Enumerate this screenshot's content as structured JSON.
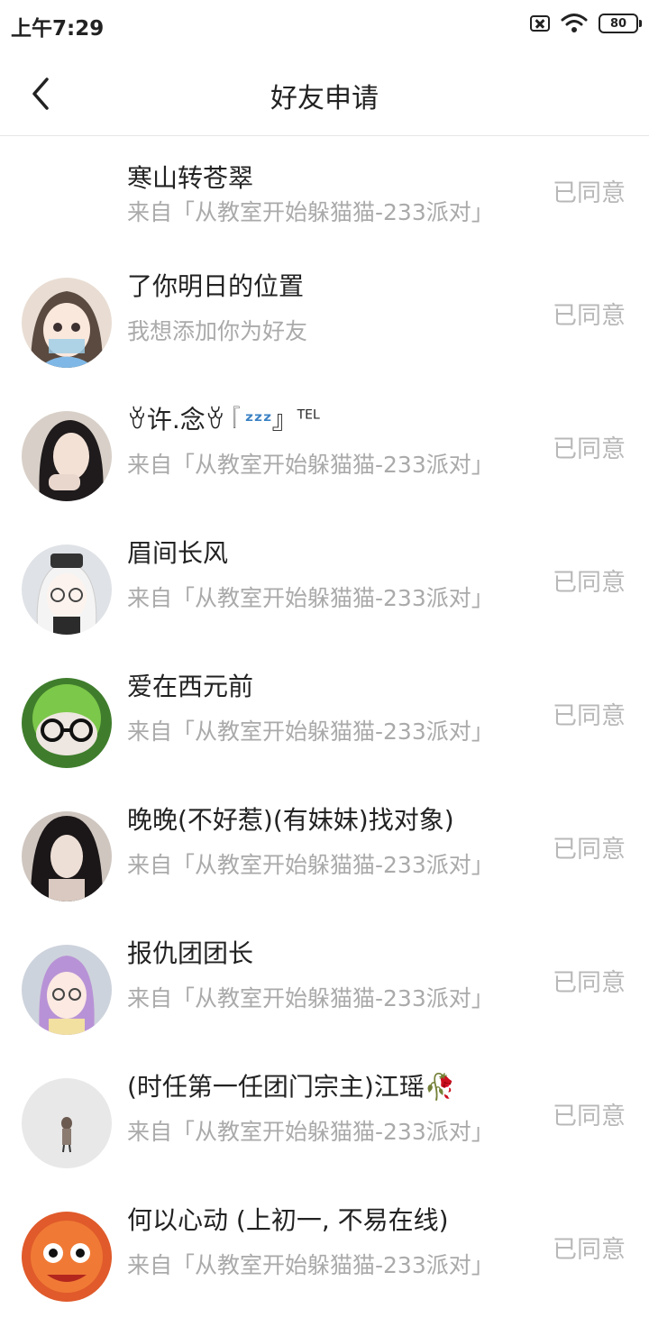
{
  "status_bar": {
    "time": "上午7:29",
    "battery": "80"
  },
  "header": {
    "title": "好友申请"
  },
  "requests": [
    {
      "name": "寒山转苍翠",
      "subtitle": "来自「从教室开始躲猫猫-233派对」",
      "status": "已同意",
      "avatar": "none"
    },
    {
      "name": "了你明日的位置",
      "subtitle": "我想添加你为好友",
      "status": "已同意",
      "avatar": "anime-girl"
    },
    {
      "name": "ꈊ许.念ꈊ『",
      "name_suffix": "』",
      "name_sup": "TEL",
      "subtitle": "来自「从教室开始躲猫猫-233派对」",
      "status": "已同意",
      "avatar": "photo-girl"
    },
    {
      "name": "眉间长风",
      "subtitle": "来自「从教室开始躲猫猫-233派对」",
      "status": "已同意",
      "avatar": "white-hair-character"
    },
    {
      "name": "爱在西元前",
      "subtitle": "来自「从教室开始躲猫猫-233派对」",
      "status": "已同意",
      "avatar": "green-plush-glasses"
    },
    {
      "name": "晚晚(不好惹)(有妹妹)找对象)",
      "subtitle": "来自「从教室开始躲猫猫-233派对」",
      "status": "已同意",
      "avatar": "dark-hair-girl"
    },
    {
      "name": "报仇团团长",
      "subtitle": "来自「从教室开始躲猫猫-233派对」",
      "status": "已同意",
      "avatar": "purple-hair-character"
    },
    {
      "name": "(时任第一任团门宗主)江瑶",
      "subtitle": "来自「从教室开始躲猫猫-233派对」",
      "status": "已同意",
      "avatar": "small-figure"
    },
    {
      "name": "何以心动 (上初一, 不易在线)",
      "subtitle": "来自「从教室开始躲猫猫-233派对」",
      "status": "已同意",
      "avatar": "orange-lion-mask"
    }
  ],
  "colors": {
    "status_text": "#b8b8b8",
    "subtitle_text": "#aaaaaa",
    "divider": "#e6e6e6"
  }
}
